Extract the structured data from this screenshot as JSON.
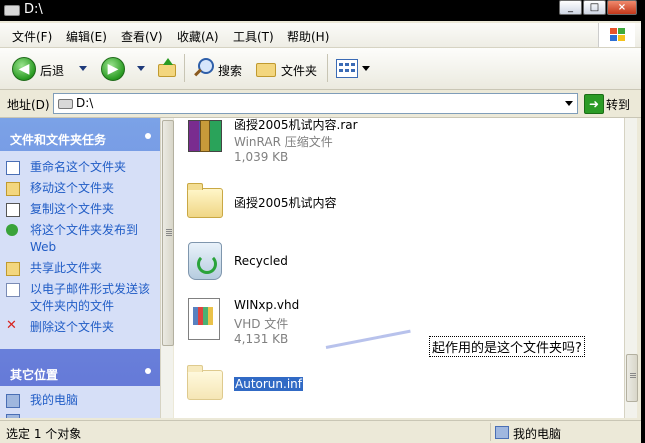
{
  "window": {
    "title": "D:\\",
    "controls": [
      "_",
      "□",
      "×"
    ]
  },
  "menu": [
    "文件(F)",
    "编辑(E)",
    "查看(V)",
    "收藏(A)",
    "工具(T)",
    "帮助(H)"
  ],
  "toolbar": {
    "back_label": "后退",
    "search_label": "搜索",
    "folders_label": "文件夹"
  },
  "address": {
    "label": "地址(D)",
    "value": "D:\\",
    "go_label": "转到"
  },
  "left_pane": {
    "tasks_title": "文件和文件夹任务",
    "tasks": [
      {
        "label": "重命名这个文件夹",
        "icon": "rename-icon"
      },
      {
        "label": "移动这个文件夹",
        "icon": "move-icon"
      },
      {
        "label": "复制这个文件夹",
        "icon": "copy-icon"
      },
      {
        "label": "将这个文件夹发布到 Web",
        "icon": "publish-web-icon"
      },
      {
        "label": "共享此文件夹",
        "icon": "share-icon"
      },
      {
        "label": "以电子邮件形式发送该文件夹内的文件",
        "icon": "email-icon"
      },
      {
        "label": "删除这个文件夹",
        "icon": "delete-icon"
      }
    ],
    "places_title": "其它位置",
    "places": [
      {
        "label": "我的电脑",
        "icon": "my-computer-icon"
      },
      {
        "label": "",
        "icon": "partially-visible-icon"
      }
    ]
  },
  "files": [
    {
      "name": "函授2005机试内容.rar",
      "type": "WinRAR 压缩文件",
      "size": "1,039 KB",
      "icon": "winrar-archive-icon"
    },
    {
      "name": "函授2005机试内容",
      "type": "",
      "size": "",
      "icon": "folder-icon"
    },
    {
      "name": "Recycled",
      "type": "",
      "size": "",
      "icon": "recycle-bin-icon"
    },
    {
      "name": "WINxp.vhd",
      "type": "VHD 文件",
      "size": "4,131 KB",
      "icon": "vhd-file-icon"
    },
    {
      "name": "Autorun.inf",
      "type": "",
      "size": "",
      "icon": "folder-icon",
      "selected": true
    }
  ],
  "annotation": "起作用的是这个文件夹吗?",
  "status": {
    "left": "选定 1 个对象",
    "right": "我的电脑"
  },
  "colors": {
    "task_link": "#215dc6",
    "selection": "#316ac5",
    "pane_gradient_top": "#7ba2e7",
    "pane_gradient_bottom": "#6375d6"
  }
}
